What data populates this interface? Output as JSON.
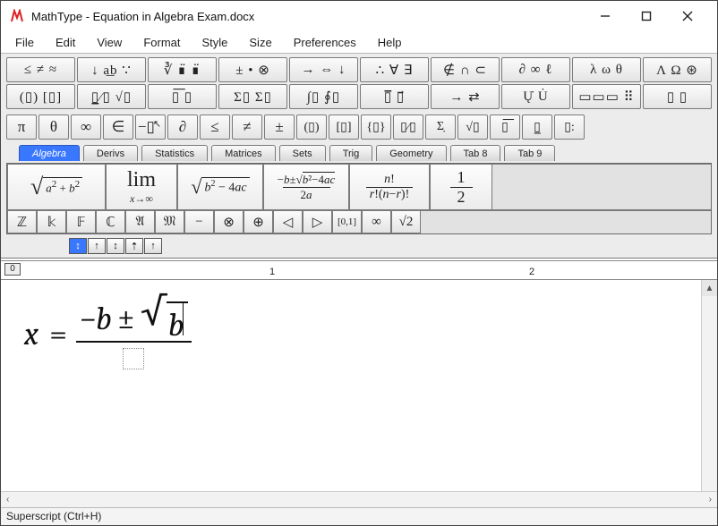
{
  "window": {
    "title": "MathType - Equation in Algebra Exam.docx"
  },
  "menu": [
    "File",
    "Edit",
    "View",
    "Format",
    "Style",
    "Size",
    "Preferences",
    "Help"
  ],
  "toolbar_row1": [
    "≤ ≠ ≈",
    "↓ a͟b ∵",
    "∛ ∎̈ ∎̈",
    "± • ⊗",
    "→ ⇔ ↓",
    "∴ ∀ ∃",
    "∉ ∩ ⊂",
    "∂ ∞ ℓ",
    "λ ω θ",
    "Λ Ω ⊛"
  ],
  "toolbar_row2": [
    "(▯) [▯]",
    "▯̲⁄▯ √▯",
    "▯͞  ▯",
    "Σ▯ Σ▯",
    "∫▯ ∮▯",
    "▯̅  ▯⃗",
    "→  ⇄",
    "Ų̇  U̇",
    "▭▭▭ ⠿",
    "▯  ▯"
  ],
  "symbol_row": {
    "buttons": [
      "π",
      "θ",
      "∞",
      "∈",
      "−▯",
      "∂",
      "≤",
      "≠",
      "±",
      "(▯)",
      "[▯]",
      "{▯}",
      "▯⁄▯",
      "Σ̣",
      "√▯",
      "▯͞",
      "▯̲",
      "▯:"
    ],
    "cursor_hint": "↖"
  },
  "tabs": [
    "Algebra",
    "Derivs",
    "Statistics",
    "Matrices",
    "Sets",
    "Trig",
    "Geometry",
    "Tab 8",
    "Tab 9"
  ],
  "active_tab": 0,
  "templates": [
    {
      "display": "sqrt_a2b2"
    },
    {
      "display": "lim_xinf"
    },
    {
      "display": "sqrt_disc"
    },
    {
      "display": "quad_num"
    },
    {
      "display": "nchooser"
    },
    {
      "display": "onehalf"
    }
  ],
  "mini_row": [
    "ℤ",
    "𝕜",
    "𝔽",
    "ℂ",
    "𝔄",
    "𝔐",
    "−",
    "⊗",
    "⊕",
    "◁",
    "▷",
    "[0,1]",
    "∞",
    "√2"
  ],
  "micro_row": [
    "↕",
    "↑",
    "↕",
    "⇡",
    "↑"
  ],
  "ruler": {
    "marks": [
      "0",
      "1",
      "2"
    ]
  },
  "equation": {
    "variable": "x",
    "equals": "=",
    "num_minus_b": "−b",
    "pm": "±",
    "radicand": "b"
  },
  "status": "Superscript (Ctrl+H)"
}
